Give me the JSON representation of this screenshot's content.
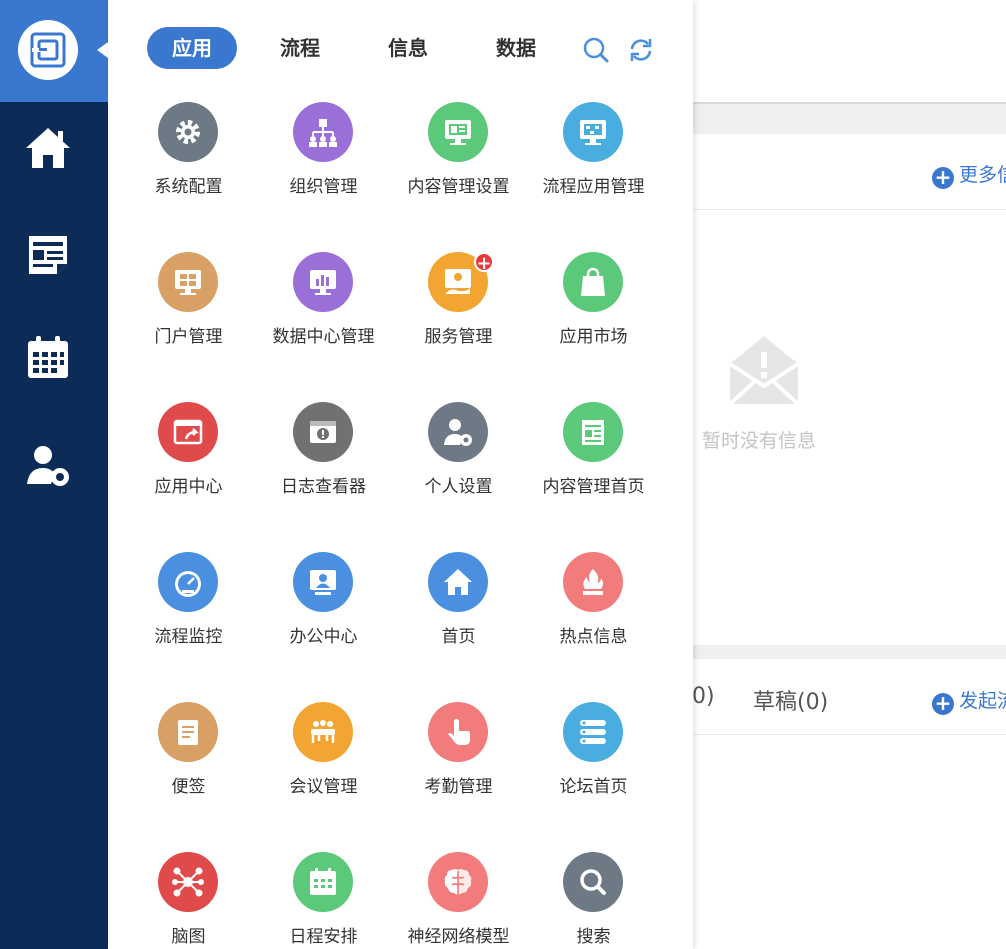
{
  "panel": {
    "tabs": [
      {
        "label": "应用",
        "active": true
      },
      {
        "label": "流程",
        "active": false
      },
      {
        "label": "信息",
        "active": false
      },
      {
        "label": "数据",
        "active": false
      }
    ],
    "apps": [
      {
        "label": "系统配置",
        "color": "#6d7a86",
        "icon": "gear-icon"
      },
      {
        "label": "组织管理",
        "color": "#9b6fd8",
        "icon": "org-icon"
      },
      {
        "label": "内容管理设置",
        "color": "#5cc97a",
        "icon": "monitor-icon"
      },
      {
        "label": "流程应用管理",
        "color": "#4aade0",
        "icon": "flow-monitor-icon"
      },
      {
        "label": "门户管理",
        "color": "#d9a066",
        "icon": "portal-icon"
      },
      {
        "label": "数据中心管理",
        "color": "#9b6fd8",
        "icon": "chart-monitor-icon"
      },
      {
        "label": "服务管理",
        "color": "#f2a531",
        "icon": "service-icon",
        "badge": "+"
      },
      {
        "label": "应用市场",
        "color": "#5cc97a",
        "icon": "shopping-bag-icon"
      },
      {
        "label": "应用中心",
        "color": "#e04a4a",
        "icon": "app-window-icon"
      },
      {
        "label": "日志查看器",
        "color": "#717171",
        "icon": "log-icon"
      },
      {
        "label": "个人设置",
        "color": "#6d7a86",
        "icon": "user-gear-icon"
      },
      {
        "label": "内容管理首页",
        "color": "#5cc97a",
        "icon": "notepad-icon"
      },
      {
        "label": "流程监控",
        "color": "#4a8fe0",
        "icon": "gauge-icon"
      },
      {
        "label": "办公中心",
        "color": "#4a8fe0",
        "icon": "office-icon"
      },
      {
        "label": "首页",
        "color": "#4a8fe0",
        "icon": "home-icon"
      },
      {
        "label": "热点信息",
        "color": "#f27b7b",
        "icon": "fire-icon"
      },
      {
        "label": "便签",
        "color": "#d9a066",
        "icon": "memo-icon"
      },
      {
        "label": "会议管理",
        "color": "#f2a531",
        "icon": "meeting-icon"
      },
      {
        "label": "考勤管理",
        "color": "#f27b7b",
        "icon": "touch-icon"
      },
      {
        "label": "论坛首页",
        "color": "#4aade0",
        "icon": "forum-icon"
      },
      {
        "label": "脑图",
        "color": "#e04a4a",
        "icon": "mindmap-icon"
      },
      {
        "label": "日程安排",
        "color": "#5cc97a",
        "icon": "calendar-icon"
      },
      {
        "label": "神经网络模型",
        "color": "#f27b7b",
        "icon": "brain-icon"
      },
      {
        "label": "搜索",
        "color": "#6d7a86",
        "icon": "search-icon"
      }
    ]
  },
  "background": {
    "more_link": "更多信",
    "empty_text": "暂时没有信息",
    "tab_partial": "0)",
    "tab_drafts": "草稿(0)",
    "start_link": "发起流"
  },
  "colors": {
    "accent": "#3a78cf",
    "rail": "#0c2b57"
  }
}
